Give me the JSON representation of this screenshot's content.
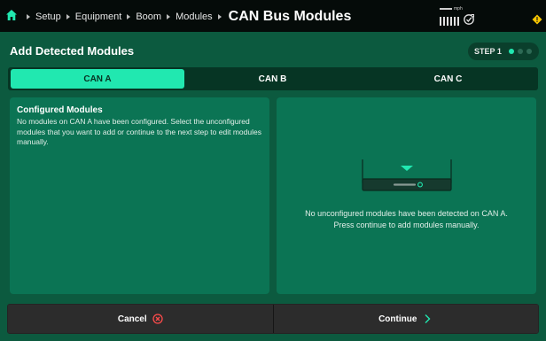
{
  "breadcrumb": {
    "items": [
      "Setup",
      "Equipment",
      "Boom",
      "Modules"
    ],
    "current": "CAN Bus Modules"
  },
  "status_bar": {
    "speed_unit": "mph"
  },
  "header": {
    "title": "Add Detected Modules",
    "step_label": "STEP 1",
    "step_current": 1,
    "step_total": 3
  },
  "tabs": [
    {
      "label": "CAN A",
      "active": true
    },
    {
      "label": "CAN B",
      "active": false
    },
    {
      "label": "CAN C",
      "active": false
    }
  ],
  "configured": {
    "title": "Configured Modules",
    "description": "No modules on CAN A have been configured. Select the unconfigured modules that you want to add or continue to the next step to edit modules manually."
  },
  "unconfigured": {
    "message_line1": "No unconfigured modules have been detected on CAN A.",
    "message_line2": "Press continue to add modules manually."
  },
  "footer": {
    "cancel_label": "Cancel",
    "continue_label": "Continue"
  },
  "colors": {
    "background": "#0c5a3f",
    "accent": "#21e8b0",
    "panel": "#0b7454",
    "top_bar": "#050b09",
    "button": "#2c2c2c",
    "cancel_icon": "#ff4b4b",
    "warning": "#f5c400"
  },
  "icons": [
    "home-icon",
    "signal-bars-icon",
    "gps-icon",
    "warning-icon",
    "cancel-circle-icon",
    "chevron-right-icon",
    "module-device-icon"
  ]
}
